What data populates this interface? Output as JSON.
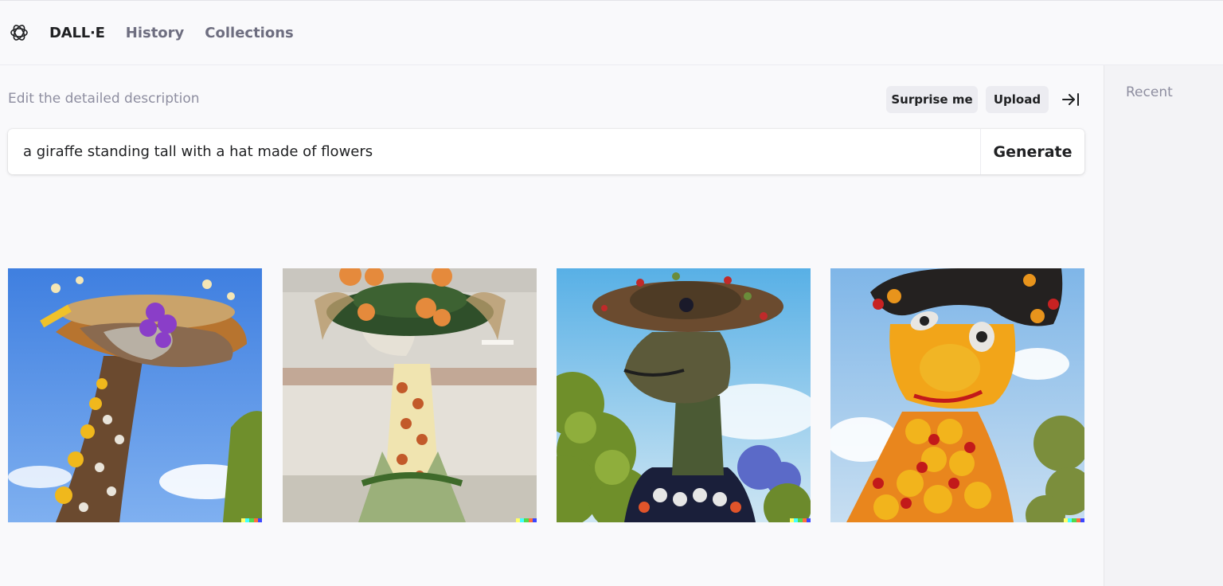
{
  "header": {
    "logo_icon": "openai-logo-icon",
    "brand": "DALL·E",
    "nav": [
      {
        "label": "History"
      },
      {
        "label": "Collections"
      }
    ]
  },
  "editor": {
    "caption": "Edit the detailed description",
    "surprise_label": "Surprise me",
    "upload_label": "Upload",
    "collapse_icon": "arrow-right-to-line-icon",
    "prompt_value": "a giraffe standing tall with a hat made of flowers",
    "generate_label": "Generate"
  },
  "results": {
    "images": [
      {
        "subject": "giraffe-flower-hat-1"
      },
      {
        "subject": "giraffe-flower-hat-2"
      },
      {
        "subject": "giraffe-flower-hat-3"
      },
      {
        "subject": "giraffe-flower-hat-4"
      }
    ],
    "signature_colors": [
      "#ffff66",
      "#42ffff",
      "#51da4c",
      "#ff6e3c",
      "#3c46ff"
    ]
  },
  "sidebar": {
    "title": "Recent"
  }
}
